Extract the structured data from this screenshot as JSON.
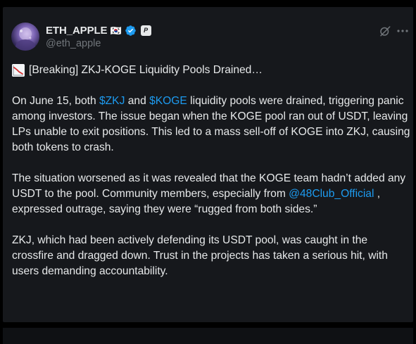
{
  "author": {
    "display_name": "ETH_APPLE",
    "flag": "🇰🇷",
    "handle": "@eth_apple",
    "affiliate_badge": "P"
  },
  "icons": {
    "verified": "verified-badge-icon",
    "grok": "grok-icon",
    "more": "more-options-icon",
    "headline_emoji": "chart-decreasing-icon"
  },
  "colors": {
    "card_background": "#16181c",
    "page_background": "#000000",
    "text": "#e7e9ea",
    "secondary_text": "#71767b",
    "link": "#1d9bf0"
  },
  "tweet": {
    "headline": "[Breaking] ZKJ-KOGE Liquidity Pools Drained…",
    "p1": {
      "before": "On June 15, both ",
      "cashtag1": "$ZKJ",
      "middle": " and ",
      "cashtag2": "$KOGE",
      "after": " liquidity pools were drained, triggering panic among investors. The issue began when the KOGE pool ran out of USDT, leaving LPs unable to exit positions. This led to a mass sell-off of KOGE into ZKJ, causing both tokens to crash."
    },
    "p2": {
      "before": "The situation worsened as it was revealed that the KOGE team hadn’t added any USDT to the pool. Community members, especially from ",
      "mention": "@48Club_Official",
      "after": " , expressed outrage, saying they were “rugged from both sides.”"
    },
    "p3": "ZKJ, which had been actively defending its USDT pool, was caught in the crossfire and dragged down. Trust in the projects has taken a serious hit, with users demanding accountability."
  }
}
